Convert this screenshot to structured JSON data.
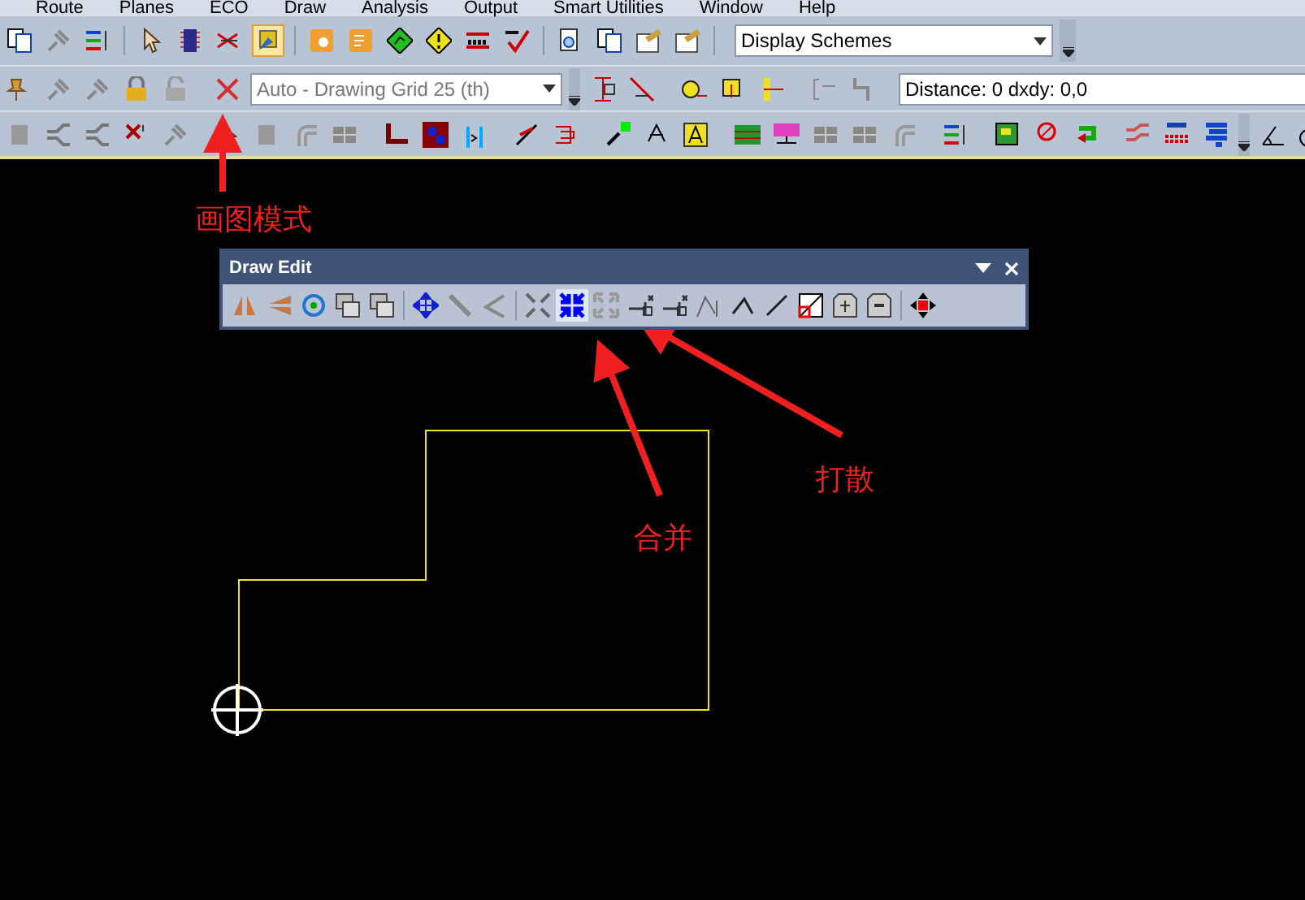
{
  "menu": [
    "Route",
    "Planes",
    "ECO",
    "Draw",
    "Analysis",
    "Output",
    "Smart Utilities",
    "Window",
    "Help"
  ],
  "draw_mode_button": {
    "selected": true
  },
  "display_schemes": {
    "value": "Display Schemes"
  },
  "grid_dropdown": {
    "value": "Auto - Drawing Grid 25 (th)"
  },
  "distance_field": {
    "value": "Distance: 0 dxdy: 0,0"
  },
  "draw_edit_toolbar": {
    "title": "Draw Edit",
    "merge_selected": true
  },
  "annotations": [
    {
      "text": "画图模式"
    },
    {
      "text": "合并"
    },
    {
      "text": "打散"
    }
  ]
}
